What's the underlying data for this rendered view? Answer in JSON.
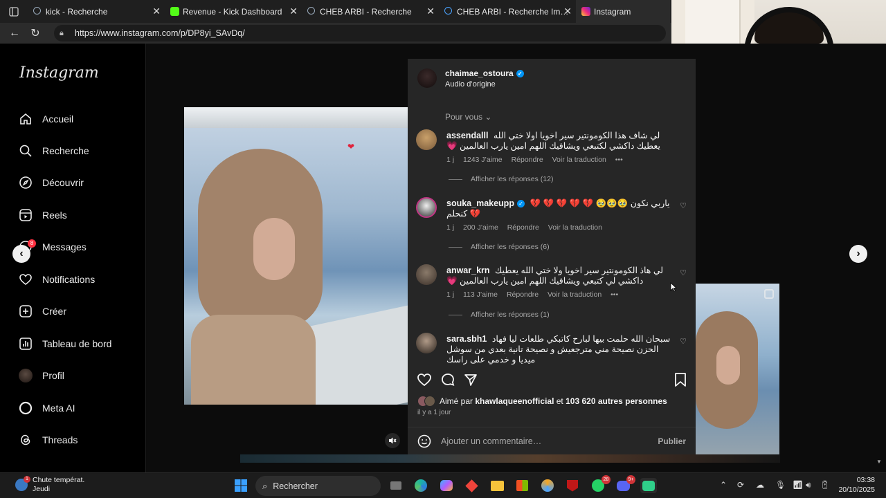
{
  "browser": {
    "tabs": [
      {
        "title": "kick - Recherche",
        "favicon_color": "#3b3b3b"
      },
      {
        "title": "Revenue - Kick Dashboard",
        "favicon_color": "#53fc18"
      },
      {
        "title": "CHEB ARBI - Recherche",
        "favicon_color": "#3b3b3b"
      },
      {
        "title": "CHEB ARBI - Recherche Images",
        "favicon_color": "#3b3b3b"
      },
      {
        "title": "Instagram",
        "favicon_color": "#e1306c"
      }
    ],
    "url": "https://www.instagram.com/p/DP8yi_SAvDq/"
  },
  "sidebar": {
    "logo": "Instagram",
    "items": [
      {
        "label": "Accueil",
        "icon": "home-icon"
      },
      {
        "label": "Recherche",
        "icon": "search-icon"
      },
      {
        "label": "Découvrir",
        "icon": "compass-icon"
      },
      {
        "label": "Reels",
        "icon": "reels-icon"
      },
      {
        "label": "Messages",
        "icon": "messenger-icon",
        "badge": "8"
      },
      {
        "label": "Notifications",
        "icon": "heart-icon"
      },
      {
        "label": "Créer",
        "icon": "plus-icon"
      },
      {
        "label": "Tableau de bord",
        "icon": "dashboard-icon"
      },
      {
        "label": "Profil",
        "icon": "avatar-icon"
      },
      {
        "label": "Meta AI",
        "icon": "meta-ai-icon"
      },
      {
        "label": "Threads",
        "icon": "threads-icon"
      }
    ]
  },
  "post": {
    "username": "chaimae_ostoura",
    "audio": "Audio d’origine",
    "sort_label": "Pour vous",
    "comments": [
      {
        "user": "assendalll",
        "text": "لي شاف هذا الكومونتير سير اخويا اولا ختي الله يعطيك داكشي لكتبعي ويشافيك اللهم امين يارب العالمين 💗",
        "time": "1 j",
        "likes": "1243 J’aime",
        "reply": "Répondre",
        "translate": "Voir la traduction",
        "more": "•••",
        "replies": "Afficher les réponses (12)"
      },
      {
        "user": "souka_makeupp",
        "verified": true,
        "text": "ياربي نكون 🥹🥹🥹 💔 💔 💔 💔 💔 💔 كنحلم",
        "time": "1 j",
        "likes": "200 J’aime",
        "reply": "Répondre",
        "translate": "Voir la traduction",
        "replies": "Afficher les réponses (6)"
      },
      {
        "user": "anwar_krn",
        "text": "لي هاذ الكومونتير سير اخويا ولا ختي الله يعطيك داكشي لي كتبعي ويشافيك اللهم امين يارب العالمين 💗",
        "time": "1 j",
        "likes": "113 J’aime",
        "reply": "Répondre",
        "translate": "Voir la traduction",
        "more": "•••",
        "replies": "Afficher les réponses (1)"
      },
      {
        "user": "sara.sbh1",
        "text": "سبحان الله حلمت بيها لبارح كاتبكي طلعات ليا فهاد الحزن نصيحة مني مترجعيش و نصيحة تانية بعدي من سوشل ميديا و خدمي على راسك"
      }
    ],
    "liked_by_prefix": "Aimé par",
    "liked_by_user": "khawlaqueenofficial",
    "liked_by_and": "et",
    "liked_by_count": "103 620 autres personnes",
    "time_ago": "il y a 1 jour",
    "comment_placeholder": "Ajouter un commentaire…",
    "publish": "Publier"
  },
  "taskbar": {
    "weather_title": "Chute températ.",
    "weather_sub": "Jeudi",
    "weather_badge": "1",
    "search": "Rechercher",
    "whatsapp_badge": "28",
    "discord_badge": "9+",
    "time": "03:38",
    "date": "20/10/2025"
  },
  "colors": {
    "panel": "#262626",
    "accent_blue": "#0095f6",
    "like_red": "#ff3040"
  }
}
